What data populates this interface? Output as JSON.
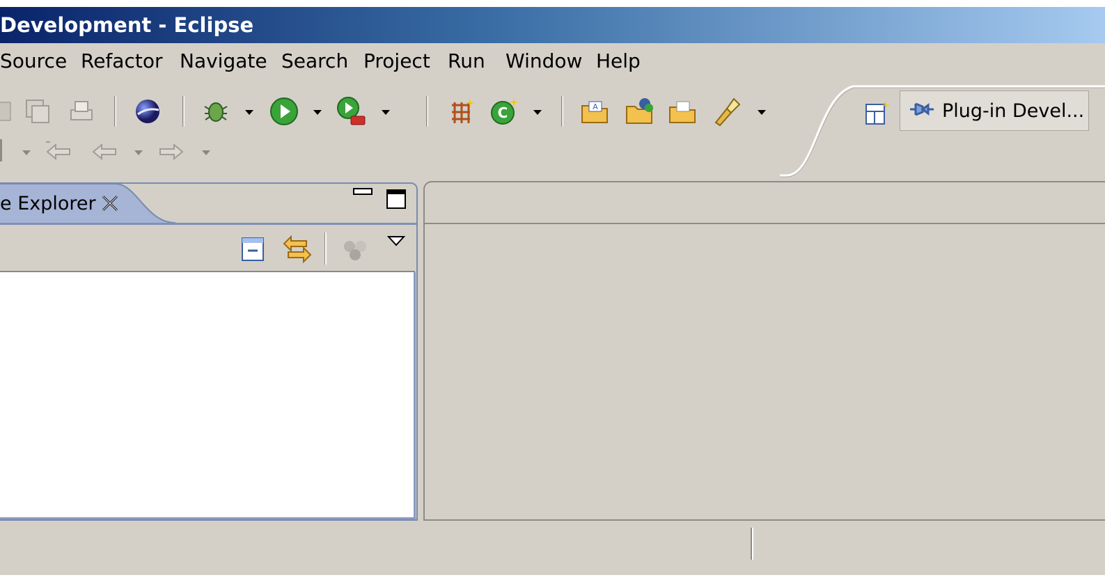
{
  "window": {
    "title": "Development - Eclipse"
  },
  "menu": {
    "items": [
      "Source",
      "Refactor",
      "Navigate",
      "Search",
      "Project",
      "Run",
      "Window",
      "Help"
    ]
  },
  "toolbar": {
    "icons": [
      "save-icon",
      "save-all-icon",
      "print-icon",
      "web-browser-icon",
      "debug-icon",
      "run-icon",
      "run-external-icon",
      "new-plugin-project-icon",
      "new-class-icon",
      "open-type-icon",
      "open-resource-icon",
      "open-project-icon",
      "search-flashlight-icon"
    ],
    "nav_icons": [
      "last-edit-icon",
      "back-icon",
      "forward-icon"
    ]
  },
  "perspective": {
    "label": "Plug-in Devel...",
    "open_perspective_icon": "open-perspective-icon",
    "icon": "plugin-perspective-icon"
  },
  "left_view": {
    "tab_label": "e Explorer",
    "toolbar_icons": [
      "collapse-all-icon",
      "link-with-editor-icon",
      "filter-icon",
      "view-menu-icon"
    ]
  },
  "colors": {
    "titlebar_start": "#0a246a",
    "titlebar_end": "#a6caf0",
    "background": "#d4d0c8",
    "view_border": "#7a8ab0"
  }
}
